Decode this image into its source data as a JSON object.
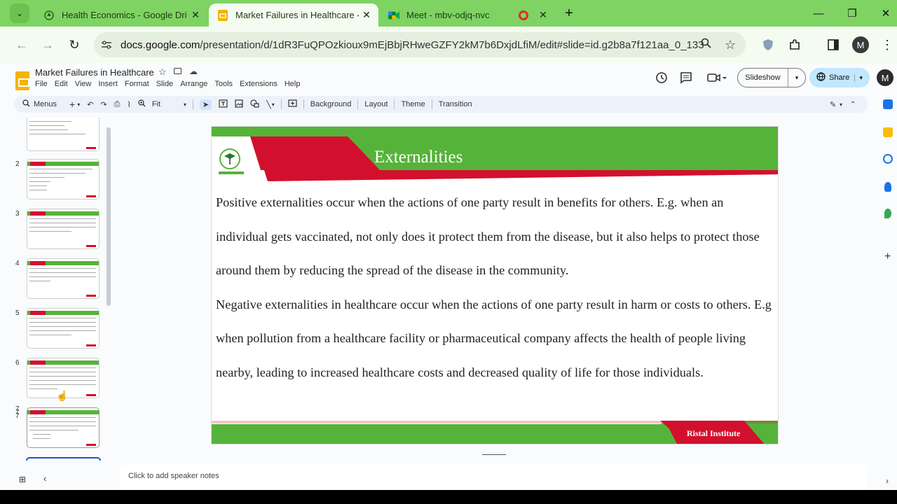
{
  "browser": {
    "tabs": [
      {
        "label": "Health Economics - Google Dri",
        "icon": "google-drive-icon",
        "active": false
      },
      {
        "label": "Market Failures in Healthcare - G",
        "icon": "google-slides-icon",
        "active": true
      },
      {
        "label": "Meet - mbv-odjq-nvc",
        "icon": "google-meet-icon",
        "active": false
      }
    ],
    "new_tab_label": "+",
    "url_host": "docs.google.com",
    "url_path": "/presentation/d/1dR3FuQPOzkioux9mEjBbjRHweGZFY2kM7b6DxjdLfiM/edit#slide=id.g2b8a7f121aa_0_133",
    "profile_initial": "M",
    "accent_color": "#7ed363"
  },
  "docs": {
    "title": "Market Failures in Healthcare",
    "menu": [
      "File",
      "Edit",
      "View",
      "Insert",
      "Format",
      "Slide",
      "Arrange",
      "Tools",
      "Extensions",
      "Help"
    ],
    "slideshow_label": "Slideshow",
    "share_label": "Share",
    "avatar_initial": "M",
    "toolbar": {
      "menus_label": "Menus",
      "zoom_label": "Fit",
      "background_label": "Background",
      "layout_label": "Layout",
      "theme_label": "Theme",
      "transition_label": "Transition"
    },
    "thumbnails": [
      {
        "number": "",
        "title": ""
      },
      {
        "number": "2",
        "title": ""
      },
      {
        "number": "3",
        "title": ""
      },
      {
        "number": "4",
        "title": ""
      },
      {
        "number": "5",
        "title": ""
      },
      {
        "number": "6",
        "title": ""
      },
      {
        "number": "7",
        "title": "",
        "selected": true
      }
    ],
    "slide": {
      "title": "Externalities",
      "paragraphs": [
        "Positive externalities occur when the actions of one party result in benefits for others. E.g. when an individual gets vaccinated, not only does it protect them from the disease, but it also helps to protect those around them by reducing the spread of the disease in the community.",
        "Negative externalities in healthcare occur when the actions of one party result in harm or costs to others. E.g when pollution from a healthcare facility or pharmaceutical company affects the health of people living nearby, leading to increased healthcare costs and decreased quality of life for those individuals."
      ],
      "footer": "Ristal Institute",
      "colors": {
        "green": "#56b33a",
        "red": "#d2102e"
      }
    },
    "speaker_notes_placeholder": "Click to add speaker notes"
  }
}
